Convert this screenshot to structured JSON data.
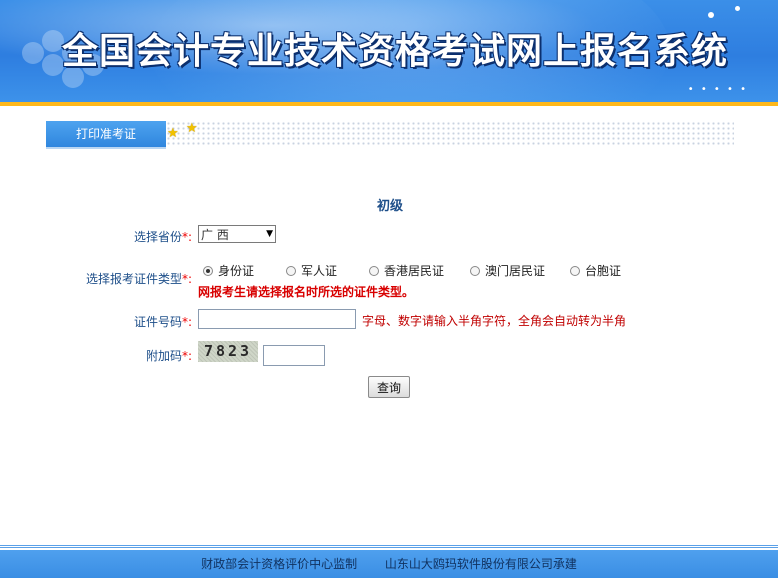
{
  "banner": {
    "title": "全国会计专业技术资格考试网上报名系统"
  },
  "tabs": {
    "print_admission": "打印准考证"
  },
  "form": {
    "level_title": "初级",
    "province_label": "选择省份",
    "province_value": "广 西",
    "id_type_label": "选择报考证件类型",
    "id_types": [
      "身份证",
      "军人证",
      "香港居民证",
      "澳门居民证",
      "台胞证"
    ],
    "id_type_selected": "身份证",
    "id_type_warning": "网报考生请选择报名时所选的证件类型。",
    "id_number_label": "证件号码",
    "id_number_value": "",
    "id_number_hint": "字母、数字请输入半角字符，全角会自动转为半角",
    "captcha_label": "附加码",
    "captcha_text": "7823",
    "captcha_value": "",
    "required_mark": "*:",
    "query_button": "查询"
  },
  "footer": {
    "supervisor": "财政部会计资格评价中心监制",
    "contractor": "山东山大鸥玛软件股份有限公司承建"
  },
  "colors": {
    "banner_blue": "#2e7ee0",
    "accent_orange": "#ffb81a",
    "label_blue": "#1d4e89",
    "warning_red": "#d80000"
  }
}
